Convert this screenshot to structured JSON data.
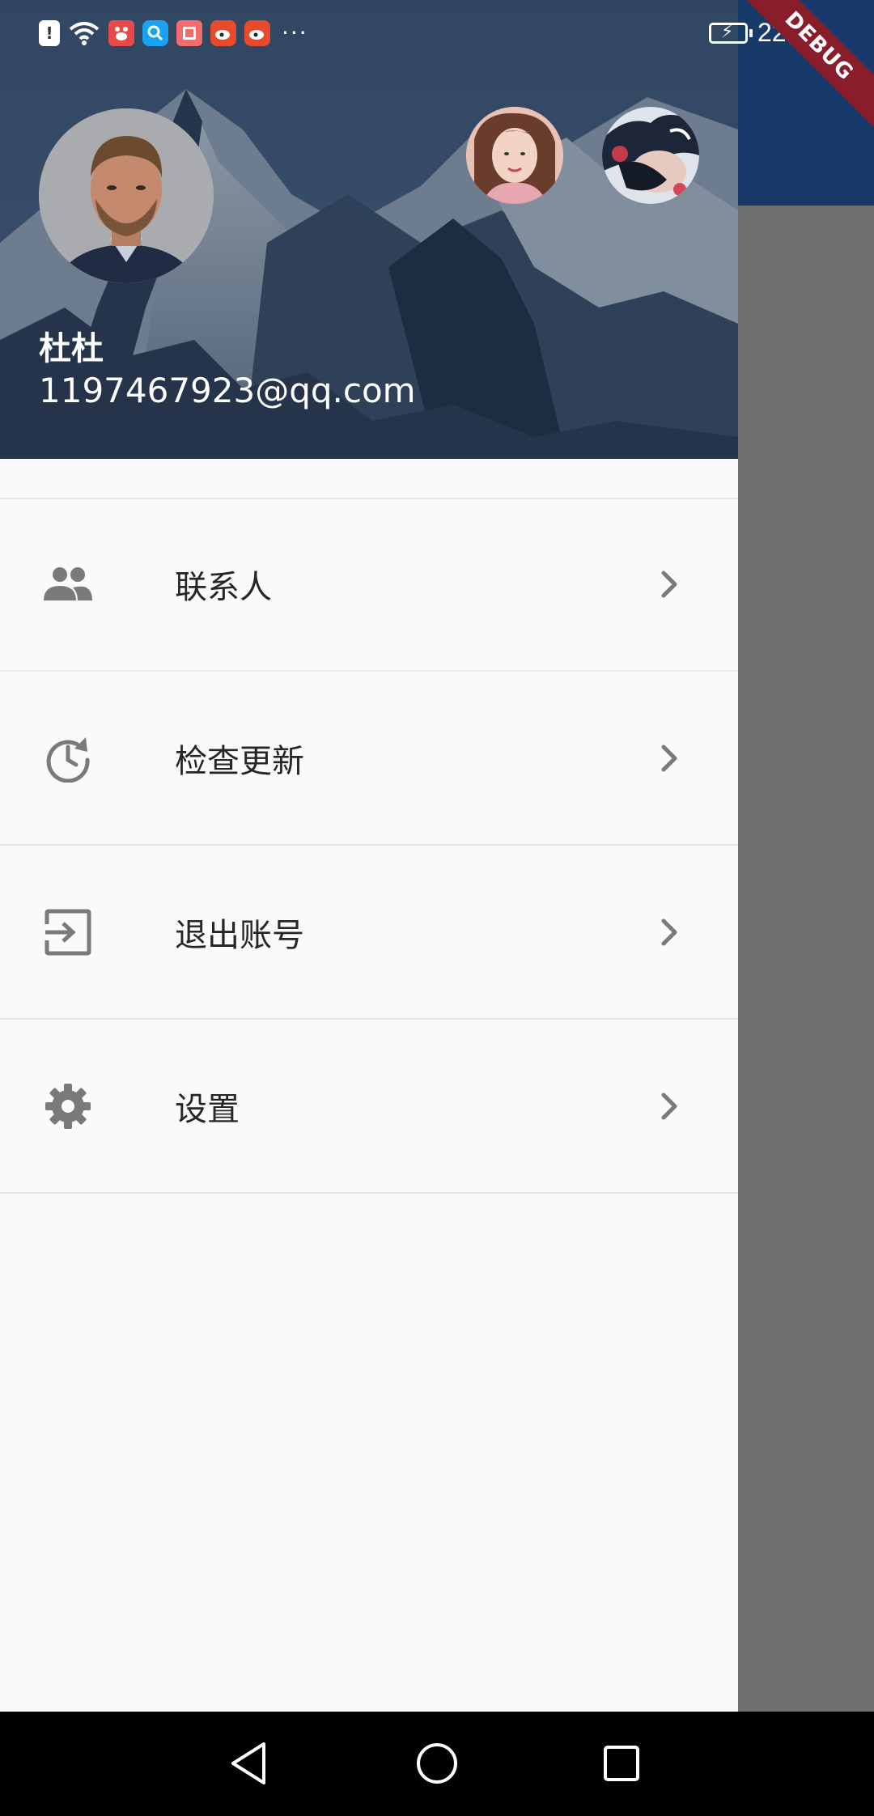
{
  "status_bar": {
    "time": "22:16",
    "left_icons": [
      "alert-icon",
      "wifi-icon",
      "baidu-icon",
      "search-app-icon",
      "book-app-icon",
      "weibo-icon",
      "weibo-icon"
    ],
    "more": "···"
  },
  "debug_banner": {
    "label": "DEBUG"
  },
  "header": {
    "user_name": "杜杜",
    "user_email": "1197467923@qq.com"
  },
  "menu": {
    "items": [
      {
        "label": "联系人",
        "icon": "contacts-icon"
      },
      {
        "label": "检查更新",
        "icon": "update-icon"
      },
      {
        "label": "退出账号",
        "icon": "logout-icon"
      },
      {
        "label": "设置",
        "icon": "settings-icon"
      }
    ]
  },
  "colors": {
    "drawer_bg": "#fafafa",
    "scrim": "#6f6f72",
    "app_bar": "#173a68",
    "debug_banner": "#8a1d2a",
    "icon_gray": "#7a7a7a"
  }
}
